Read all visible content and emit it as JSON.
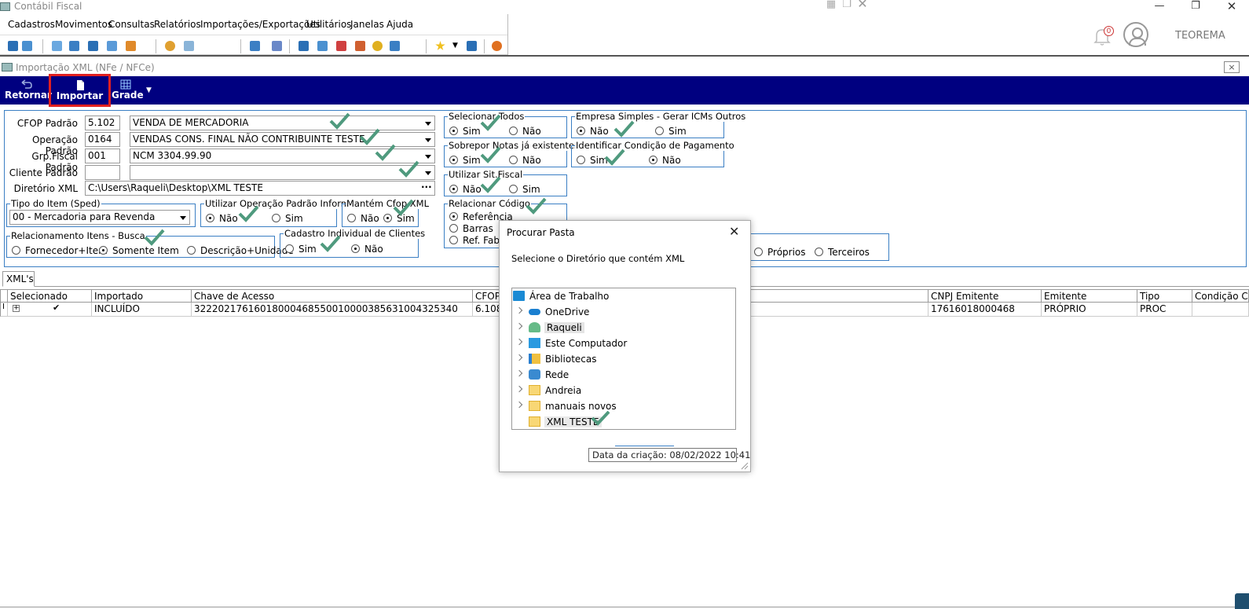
{
  "window": {
    "title": "Contábil Fiscal"
  },
  "menu": [
    "Cadastros",
    "Movimentos",
    "Consultas",
    "Relatórios",
    "Importações/Exportações",
    "Utilitários",
    "Janelas",
    "Ajuda"
  ],
  "notifications": {
    "count": "0"
  },
  "brand": "TEOREMA",
  "subwindow": {
    "title": "Importação XML (NFe / NFCe)",
    "close": "×"
  },
  "actions": {
    "back": "Retornar",
    "import": "Importar",
    "grid": "Grade"
  },
  "form": {
    "cfop_label": "CFOP Padrão",
    "cfop_code": "5.102",
    "cfop_desc": "VENDA DE MERCADORIA",
    "op_label": "Operação Padrão",
    "op_code": "0164",
    "op_desc": "VENDAS  CONS. FINAL NÃO CONTRIBUINTE TESTE",
    "grp_label": "Grp.Fiscal Padrão",
    "grp_code": "001",
    "grp_desc": "NCM 3304.99.90",
    "client_label": "Cliente Padrão",
    "client_code": "",
    "client_desc": "",
    "dir_label": "Diretório XML",
    "dir_value": "C:\\Users\\Raqueli\\Desktop\\XML TESTE",
    "dir_btn": "···",
    "tipo_item": {
      "title": "Tipo do Item (Sped)",
      "value": "00 - Mercadoria para Revenda"
    },
    "utilizar_op": {
      "title": "Utilizar Operação Padrão Informada",
      "no": "Não",
      "yes": "Sim"
    },
    "mantem_cfop": {
      "title": "Mantém Cfop XML",
      "no": "Não",
      "yes": "Sim"
    },
    "relac_itens": {
      "title": "Relacionamento Itens - Busca",
      "o1": "Fornecedor+Item",
      "o2": "Somente Item",
      "o3": "Descrição+Unidade"
    },
    "cad_individual": {
      "title": "Cadastro Individual de Clientes",
      "yes": "Sim",
      "no": "Não"
    },
    "selecionar_todos": {
      "title": "Selecionar Todos",
      "yes": "Sim",
      "no": "Não"
    },
    "sobrepor": {
      "title": "Sobrepor Notas já existentes",
      "yes": "Sim",
      "no": "Não"
    },
    "sit_fiscal": {
      "title": "Utilizar Sit.Fiscal",
      "no": "Não",
      "yes": "Sim"
    },
    "relac_codigo": {
      "title": "Relacionar Código",
      "o1": "Referência",
      "o2": "Barras",
      "o3": "Ref. Fabri"
    },
    "empresa_simples": {
      "title": "Empresa Simples - Gerar ICMs Outros",
      "no": "Não",
      "yes": "Sim"
    },
    "cond_pagto": {
      "title": "Identificar Condição de Pagamento",
      "yes": "Sim",
      "no": "Não"
    },
    "origem": {
      "o1": "Próprios",
      "o2": "Terceiros"
    }
  },
  "tab": "XML's",
  "grid": {
    "headers": [
      "Selecionado",
      "Importado",
      "Chave de Acesso",
      "CFOP",
      "CNPJ Emitente",
      "Emitente",
      "Tipo",
      "Condição Cód"
    ],
    "row": {
      "importado": "INCLUÍDO",
      "chave": "32220217616018000468550010000385631004325340",
      "cfop": "6.108",
      "cnpj": "17616018000468",
      "emitente": "PRÓPRIO",
      "tipo": "PROC",
      "cond": ""
    }
  },
  "dialog": {
    "title": "Procurar Pasta",
    "close": "✕",
    "description": "Selecione o Diretório que contém XML",
    "tree": [
      "Área de Trabalho",
      "OneDrive",
      "Raqueli",
      "Este Computador",
      "Bibliotecas",
      "Rede",
      "Andreia",
      "manuais novos",
      "XML TESTE"
    ],
    "tooltip": "Data da criação: 08/02/2022 10:41"
  },
  "colors": {
    "accent": "#000080",
    "check": "#4f9a7e",
    "highlight": "#e02020",
    "border": "#3b7fc4"
  }
}
